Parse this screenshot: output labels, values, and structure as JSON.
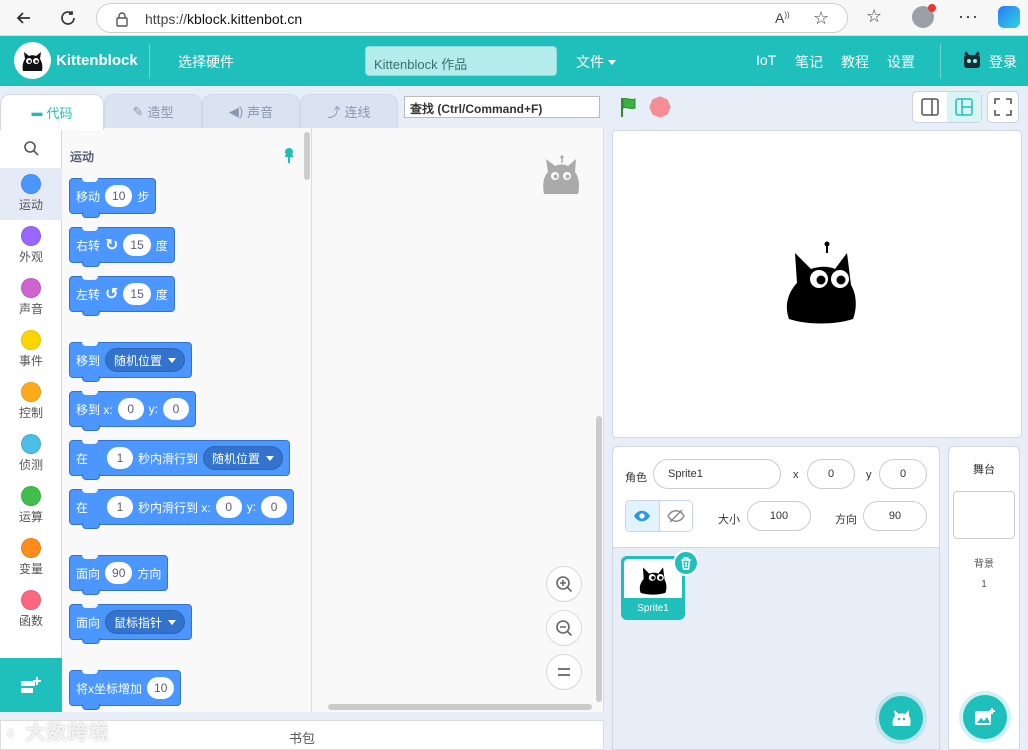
{
  "browser": {
    "url_prefix": "https://",
    "url_host": "kblock.kittenbot.cn"
  },
  "header": {
    "brand": "Kittenblock",
    "select_hardware": "选择硬件",
    "project_title": "Kittenblock 作品",
    "file_menu": "文件",
    "iot": "IoT",
    "notes": "笔记",
    "tutorials": "教程",
    "settings": "设置",
    "login": "登录"
  },
  "tabs": {
    "code": "代码",
    "costumes": "造型",
    "sounds": "声音",
    "wiring": "连线"
  },
  "search": {
    "value": "查找 (Ctrl/Command+F)"
  },
  "categories": [
    {
      "label": "运动",
      "color": "#4c97ff"
    },
    {
      "label": "外观",
      "color": "#9966ff"
    },
    {
      "label": "声音",
      "color": "#cf63cf"
    },
    {
      "label": "事件",
      "color": "#ffd500"
    },
    {
      "label": "控制",
      "color": "#ffab19"
    },
    {
      "label": "侦测",
      "color": "#4cbfe6"
    },
    {
      "label": "运算",
      "color": "#40bf4a"
    },
    {
      "label": "变量",
      "color": "#ff8c1a"
    },
    {
      "label": "函数",
      "color": "#ff6680"
    }
  ],
  "palette": {
    "title": "运动",
    "move": {
      "text1": "移动",
      "value": "10",
      "text2": "步"
    },
    "turn_right": {
      "text1": "右转",
      "value": "15",
      "text2": "度"
    },
    "turn_left": {
      "text1": "左转",
      "value": "15",
      "text2": "度"
    },
    "go_to": {
      "text1": "移到",
      "option": "随机位置"
    },
    "go_to_xy": {
      "text1": "移到 x:",
      "x": "0",
      "text2": "y:",
      "y": "0"
    },
    "glide_to": {
      "text1": "在",
      "secs": "1",
      "text2": "秒内滑行到",
      "option": "随机位置"
    },
    "glide_xy": {
      "text1": "在",
      "secs": "1",
      "text2": "秒内滑行到 x:",
      "x": "0",
      "text3": "y:",
      "y": "0"
    },
    "point_dir": {
      "text1": "面向",
      "value": "90",
      "text2": "方向"
    },
    "point_towards": {
      "text1": "面向",
      "option": "鼠标指针"
    },
    "change_x": {
      "text1": "将x坐标增加",
      "value": "10"
    }
  },
  "backpack": "书包",
  "sprite_info": {
    "sprite_label": "角色",
    "sprite_name": "Sprite1",
    "x_label": "x",
    "x_value": "0",
    "y_label": "y",
    "y_value": "0",
    "size_label": "大小",
    "size_value": "100",
    "direction_label": "方向",
    "direction_value": "90"
  },
  "sprites": [
    {
      "name": "Sprite1"
    }
  ],
  "stage_panel": {
    "title": "舞台",
    "backdrops_label": "背景",
    "backdrops_count": "1"
  },
  "watermark": "大数跨境",
  "colors": {
    "accent": "#1fbfbb",
    "motion": "#4c97ff"
  }
}
